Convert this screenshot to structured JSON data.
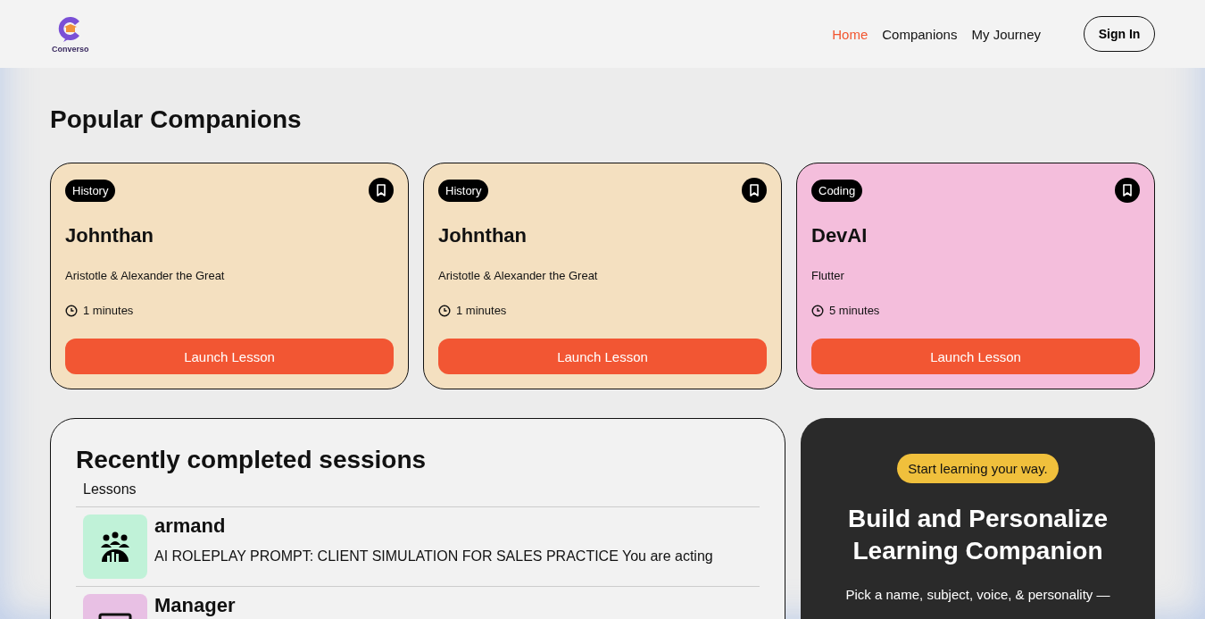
{
  "logo": {
    "name": "Converso"
  },
  "nav": [
    {
      "label": "Home",
      "selected": true
    },
    {
      "label": "Companions",
      "selected": false
    },
    {
      "label": "My Journey",
      "selected": false
    }
  ],
  "sign_in": "Sign In",
  "popular": {
    "title": "Popular Companions",
    "cards": [
      {
        "subject": "History",
        "name": "Johnthan",
        "topic": "Aristotle & Alexander the Great",
        "duration": "1 minutes",
        "action": "Launch Lesson",
        "color": "#f4e0c0"
      },
      {
        "subject": "History",
        "name": "Johnthan",
        "topic": "Aristotle & Alexander the Great",
        "duration": "1 minutes",
        "action": "Launch Lesson",
        "color": "#f4e0c0"
      },
      {
        "subject": "Coding",
        "name": "DevAI",
        "topic": "Flutter",
        "duration": "5 minutes",
        "action": "Launch Lesson",
        "color": "#f4bedc"
      }
    ]
  },
  "recent": {
    "title": "Recently completed sessions",
    "column": "Lessons",
    "rows": [
      {
        "name": "armand",
        "description": "AI ROLEPLAY PROMPT: CLIENT SIMULATION FOR SALES PRACTICE You are acting",
        "color": "#c0f2d8",
        "kind": "people"
      },
      {
        "name": "Manager",
        "color": "#e8c0e4",
        "kind": "monitor"
      }
    ]
  },
  "cta": {
    "badge": "Start learning your way.",
    "title": "Build and Personalize Learning Companion",
    "text": "Pick a name, subject, voice, & personality —"
  }
}
